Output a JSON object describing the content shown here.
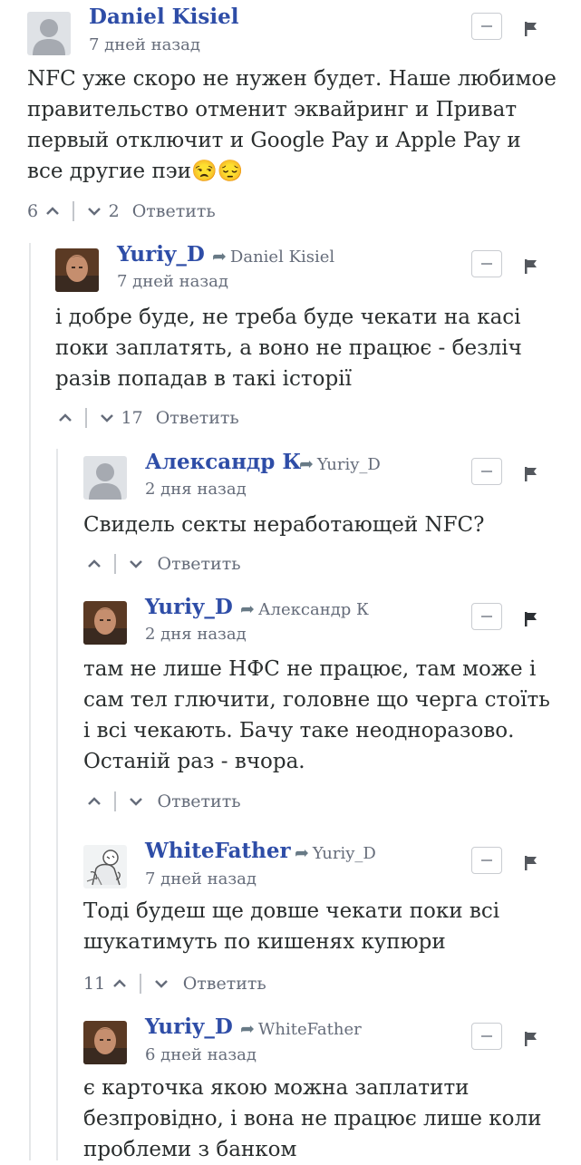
{
  "reply_label": "Ответить",
  "comments": [
    {
      "author": "Daniel Kisiel",
      "parent": "",
      "time": "7 дней назад",
      "text": "NFC уже скоро не нужен будет. Наше любимое правительство отменит эквайринг и Приват первый отключит и Google Pay и Apple Pay и все другие пэи😒😔",
      "upvotes": "6",
      "downvotes": "2",
      "avatar": "default-avatar"
    },
    {
      "author": "Yuriy_D",
      "parent": "Daniel Kisiel",
      "time": "7 дней назад",
      "text": "і добре буде, не треба буде чекати на касі поки заплатять, а воно не працює - безліч разів попадав в такі історії",
      "upvotes": "",
      "downvotes": "17",
      "avatar": "photo-avatar"
    },
    {
      "author": "Александр К",
      "parent": "Yuriy_D",
      "time": "2 дня назад",
      "text": "Свидель секты неработающей NFC?",
      "upvotes": "",
      "downvotes": "",
      "avatar": "default-avatar"
    },
    {
      "author": "Yuriy_D",
      "parent": "Александр К",
      "time": "2 дня назад",
      "text": "там не лише НФС не працює, там може і сам тел глючити, головне що черга стоїть і всі чекають. Бачу таке неодноразово. Останій раз - вчора.",
      "upvotes": "",
      "downvotes": "",
      "avatar": "photo-avatar"
    },
    {
      "author": "WhiteFather",
      "parent": "Yuriy_D",
      "time": "7 дней назад",
      "text": "Тоді будеш ще довше чекати поки всі шукатимуть по кишенях купюри",
      "upvotes": "11",
      "downvotes": "",
      "avatar": "drawing-avatar"
    },
    {
      "author": "Yuriy_D",
      "parent": "WhiteFather",
      "time": "6 дней назад",
      "text": "є карточка якою можна заплатити безпровідно, і вона не працює лише коли проблеми з банком",
      "upvotes": "",
      "downvotes": "",
      "avatar": "photo-avatar"
    }
  ],
  "colors": {
    "author": "#2e4da7",
    "meta": "#656c7a",
    "text": "#2a2e2e",
    "thread_line": "#e5e7e9"
  }
}
